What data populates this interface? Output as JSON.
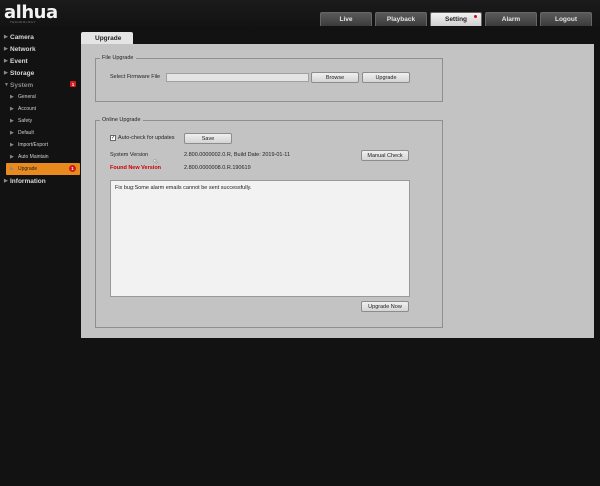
{
  "header": {
    "logo": "alhua",
    "logo_sub": "TECHNOLOGY",
    "tabs": [
      {
        "label": "Live"
      },
      {
        "label": "Playback"
      },
      {
        "label": "Setting"
      },
      {
        "label": "Alarm"
      },
      {
        "label": "Logout"
      }
    ]
  },
  "sidebar": {
    "items": [
      {
        "label": "Camera"
      },
      {
        "label": "Network"
      },
      {
        "label": "Event"
      },
      {
        "label": "Storage"
      },
      {
        "label": "System",
        "badge": "1"
      }
    ],
    "sub_items": [
      {
        "label": "General"
      },
      {
        "label": "Account"
      },
      {
        "label": "Safety"
      },
      {
        "label": "Default"
      },
      {
        "label": "Import/Export"
      },
      {
        "label": "Auto Maintain"
      },
      {
        "label": "Upgrade",
        "badge": "1"
      }
    ],
    "information": "Information"
  },
  "page": {
    "tab": "Upgrade",
    "file_upgrade": {
      "title": "File Upgrade",
      "select_label": "Select Firmware File",
      "file_value": "",
      "browse": "Browse",
      "upgrade": "Upgrade"
    },
    "online_upgrade": {
      "title": "Online Upgrade",
      "auto_check": "Auto-check for updates",
      "auto_checked": true,
      "save": "Save",
      "system_version_label": "System Version",
      "system_version_value": "2.800.0000002.0.R, Build Date: 2019-01-11",
      "manual_check": "Manual Check",
      "found_label": "Found New Version",
      "found_value": "2.800.0000008.0.R.190619",
      "notes": "Fix bug:Some alarm emails cannot be sent successfully.",
      "upgrade_now": "Upgrade Now"
    }
  },
  "colors": {
    "accent": "#e88a1e",
    "badge": "#d21d1d",
    "found_text": "#cc0000"
  }
}
